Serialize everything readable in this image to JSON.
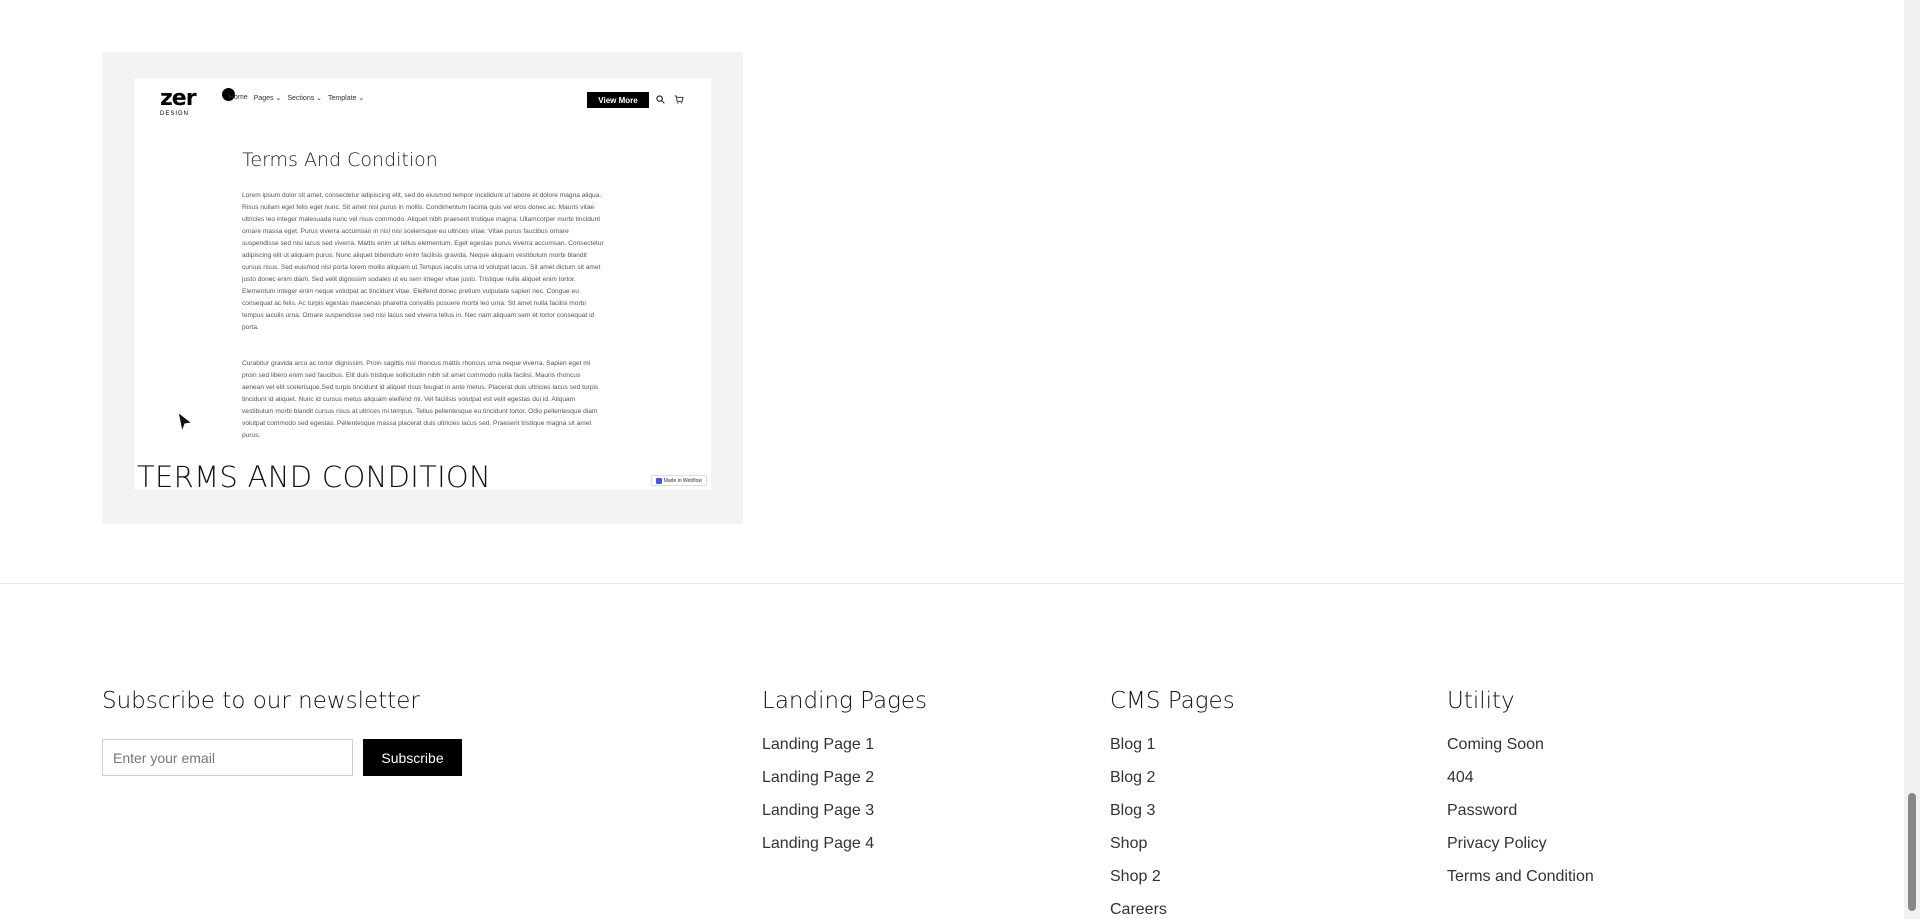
{
  "card": {
    "title": "TERMS AND CONDITION",
    "preview": {
      "logo_text": "zer",
      "logo_sub": "DESIGN",
      "nav": [
        "Home",
        "Pages ⌄",
        "Sections ⌄",
        "Template ⌄"
      ],
      "cta_label": "View More",
      "heading": "Terms And Condition",
      "paragraph_1": "Lorem ipsum dolor sit amet, consectetur adipiscing elit, sed do eiusmod tempor incididunt ut labore et dolore magna aliqua. Risus nullam eget felis eget nunc. Sit amet nisl purus in mollis. Condimentum lacinia quis vel eros donec ac. Mauris vitae ultricies leo integer malesuada nunc vel risus commodo. Aliquet nibh praesent tristique magna. Ullamcorper morbi tincidunt ornare massa eget. Purus viverra accumsan in nisl nisi scelerisque eu ultrices vitae. Vitae purus faucibus ornare suspendisse sed nisi lacus sed viverra. Mattis enim ut tellus elementum. Eget egestas purus viverra accumsan. Consectetur adipiscing elit ut aliquam purus. Nunc aliquet bibendum enim facilisis gravida. Neque aliquam vestibulum morbi blandit cursus risus. Sed euismod nisi porta lorem mollis aliquam ut.Tempus iaculis urna id volutpat lacus. Sit amet dictum sit amet justo donec enim diam. Sed velit dignissim sodales ut eu sem integer vitae justo. Tristique nulla aliquet enim tortor. Elementum integer enim neque volutpat ac tincidunt vitae. Eleifend donec pretium vulputate sapien nec. Congue eu consequat ac felis. Ac turpis egestas maecenas pharetra convallis posuere morbi leo urna. Sit amet nulla facilisi morbi tempus iaculis urna. Ornare suspendisse sed nisi lacus sed viverra tellus in. Nec nam aliquam sem et tortor consequat id porta.",
      "paragraph_2": "Curabitur gravida arcu ac tortor dignissim. Proin sagittis nisl rhoncus mattis rhoncus urna neque viverra. Sapien eget mi proin sed libero enim sed faucibus. Elit duis tristique sollicitudin nibh sit amet commodo nulla facilisi. Mauris rhoncus aenean vel elit scelerisque.Sed turpis tincidunt id aliquet risus feugiat in ante metus. Placerat duis ultricies lacus sed turpis tincidunt id aliquet. Nunc id cursus metus aliquam eleifend mi. Vel facilisis volutpat est velit egestas dui id. Aliquam vestibulum morbi blandit cursus risus at ultrices mi tempus. Tellus pellentesque eu tincidunt tortor. Odio pellentesque diam volutpat commodo sed egestas. Pellentesque massa placerat duis ultricies lacus sed. Praesent tristique magna sit amet purus.",
      "badge": "Made in Webflow"
    }
  },
  "newsletter": {
    "title": "Subscribe to our newsletter",
    "email_placeholder": "Enter your email",
    "subscribe_label": "Subscribe"
  },
  "footer": {
    "landing": {
      "title": "Landing Pages",
      "links": [
        "Landing Page 1",
        "Landing Page 2",
        "Landing Page 3",
        "Landing Page 4"
      ]
    },
    "cms": {
      "title": "CMS Pages",
      "links": [
        "Blog 1",
        "Blog 2",
        "Blog 3",
        "Shop",
        "Shop 2",
        "Careers"
      ]
    },
    "utility": {
      "title": "Utility",
      "links": [
        "Coming Soon",
        "404",
        "Password",
        "Privacy Policy",
        "Terms and Condition"
      ]
    }
  },
  "colors": {
    "card_bg": "#f3f3f3",
    "button_bg": "#000000",
    "accent_webflow": "#4353ff"
  },
  "icons": [
    "search-icon",
    "cart-icon",
    "cursor-icon",
    "webflow-icon"
  ]
}
